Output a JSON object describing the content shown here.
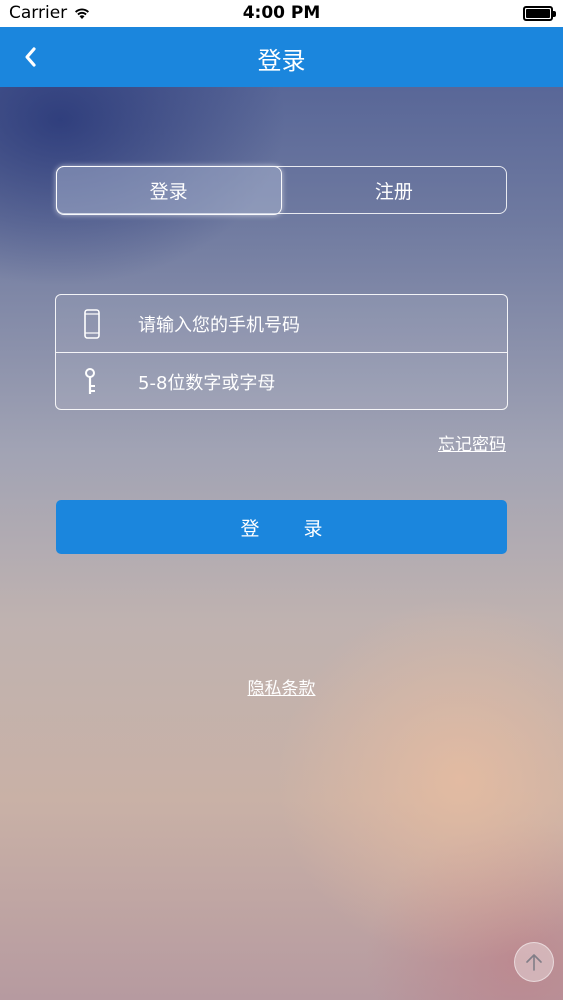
{
  "status_bar": {
    "carrier": "Carrier",
    "time": "4:00 PM",
    "wifi_icon": "wifi-icon",
    "battery_icon": "battery-icon"
  },
  "nav": {
    "title": "登录",
    "back_icon": "chevron-left-icon"
  },
  "segmented": {
    "tabs": [
      "登录",
      "注册"
    ],
    "selected": "登录"
  },
  "form": {
    "phone": {
      "placeholder": "请输入您的手机号码",
      "icon": "phone-icon"
    },
    "password": {
      "placeholder": "5-8位数字或字母",
      "icon": "key-icon"
    }
  },
  "links": {
    "forgot_password": "忘记密码",
    "privacy": "隐私条款"
  },
  "login_button": {
    "label": "登录"
  },
  "scroll_top": {
    "icon": "arrow-up-icon"
  },
  "colors": {
    "accent": "#1b86dd",
    "text": "#ffffff"
  }
}
